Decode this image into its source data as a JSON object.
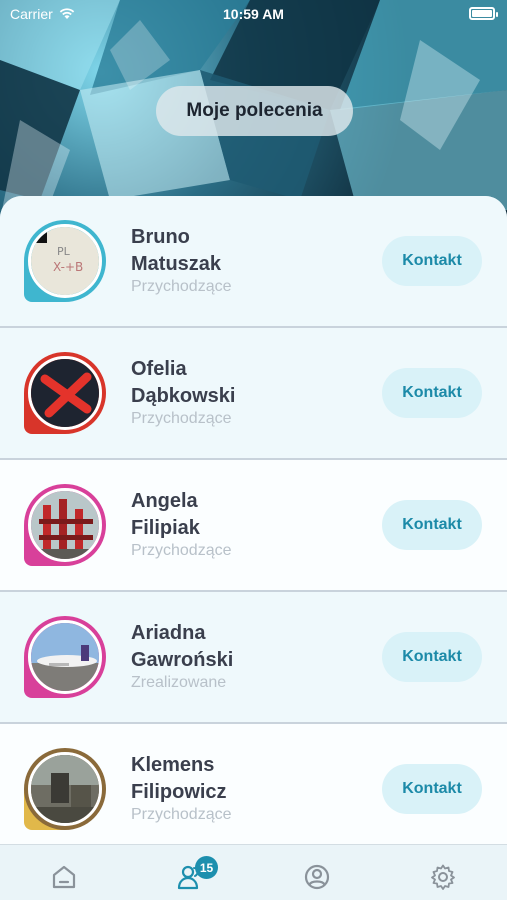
{
  "status_bar": {
    "carrier": "Carrier",
    "time": "10:59 AM"
  },
  "header": {
    "title": "Moje polecenia"
  },
  "contacts": [
    {
      "first_name": "Bruno",
      "last_name": "Matuszak",
      "status": "Przychodzące",
      "action": "Kontakt",
      "accent": "#3fb6cf"
    },
    {
      "first_name": "Ofelia",
      "last_name": "Dąbkowski",
      "status": "Przychodzące",
      "action": "Kontakt",
      "accent": "#d8352a"
    },
    {
      "first_name": "Angela",
      "last_name": "Filipiak",
      "status": "Przychodzące",
      "action": "Kontakt",
      "accent": "#d8409a"
    },
    {
      "first_name": "Ariadna",
      "last_name": "Gawroński",
      "status": "Zrealizowane",
      "action": "Kontakt",
      "accent": "#d8409a"
    },
    {
      "first_name": "Klemens",
      "last_name": "Filipowicz",
      "status": "Przychodzące",
      "action": "Kontakt",
      "accent": "#e1b84a"
    }
  ],
  "tab_bar": {
    "badge_count": "15",
    "tabs": [
      "home-icon",
      "referrals-icon",
      "profile-icon",
      "settings-icon"
    ],
    "active_color": "#1d8fae",
    "inactive_color": "#8a929a"
  }
}
